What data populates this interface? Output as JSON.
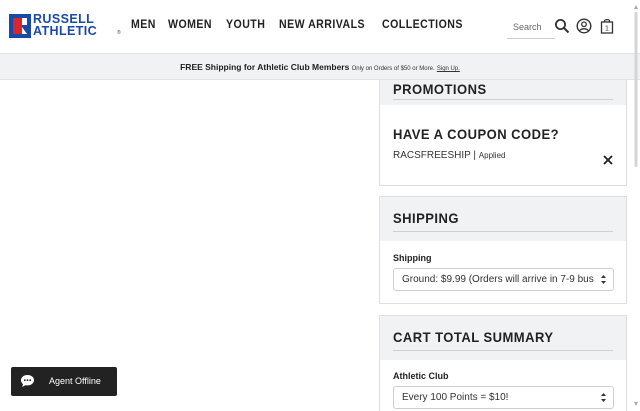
{
  "brand": {
    "line1": "RUSSELL",
    "line2": "ATHLETIC",
    "trademark": "®",
    "color": "#1a4aa6",
    "accent": "#d9262c"
  },
  "nav": {
    "items": [
      {
        "label": "MEN"
      },
      {
        "label": "WOMEN"
      },
      {
        "label": "YOUTH"
      },
      {
        "label": "NEW ARRIVALS"
      },
      {
        "label": "COLLECTIONS"
      }
    ]
  },
  "search": {
    "placeholder": "Search",
    "icon": "search-icon"
  },
  "header_icons": {
    "account": "user-circle-icon",
    "cart": "shopping-bag-icon",
    "cart_count": "1"
  },
  "promo_bar": {
    "main": "FREE Shipping for Athletic Club Members",
    "sub": "Only on Orders of $50 or More.",
    "link": "Sign Up."
  },
  "promotions": {
    "title": "PROMOTIONS",
    "coupon_title": "HAVE A COUPON CODE?",
    "coupon_code": "RACSFREESHIP",
    "separator": "|",
    "coupon_status": "Applied"
  },
  "shipping": {
    "title": "SHIPPING",
    "label": "Shipping",
    "selected": "Ground: $9.99 (Orders will arrive in 7-9 bus"
  },
  "cart_summary": {
    "title": "CART TOTAL SUMMARY",
    "club_label": "Athletic Club",
    "club_selected": "Every 100 Points = $10!"
  },
  "chat": {
    "label": "Agent Offline",
    "icon": "chat-bubble-icon"
  }
}
